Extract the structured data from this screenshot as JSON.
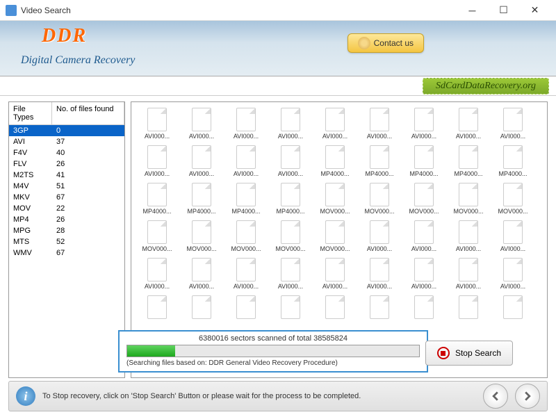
{
  "window": {
    "title": "Video Search"
  },
  "header": {
    "logo": "DDR",
    "subtitle": "Digital Camera Recovery",
    "contact": "Contact us",
    "banner": "SdCardDataRecovery.org"
  },
  "table": {
    "col1": "File Types",
    "col2": "No. of files found",
    "rows": [
      {
        "type": "3GP",
        "count": "0",
        "selected": true
      },
      {
        "type": "AVI",
        "count": "37"
      },
      {
        "type": "F4V",
        "count": "40"
      },
      {
        "type": "FLV",
        "count": "26"
      },
      {
        "type": "M2TS",
        "count": "41"
      },
      {
        "type": "M4V",
        "count": "51"
      },
      {
        "type": "MKV",
        "count": "67"
      },
      {
        "type": "MOV",
        "count": "22"
      },
      {
        "type": "MP4",
        "count": "26"
      },
      {
        "type": "MPG",
        "count": "28"
      },
      {
        "type": "MTS",
        "count": "52"
      },
      {
        "type": "WMV",
        "count": "67"
      }
    ]
  },
  "grid": {
    "rows": [
      [
        "AVI000...",
        "AVI000...",
        "AVI000...",
        "AVI000...",
        "AVI000...",
        "AVI000...",
        "AVI000...",
        "AVI000...",
        "AVI000..."
      ],
      [
        "AVI000...",
        "AVI000...",
        "AVI000...",
        "AVI000...",
        "MP4000...",
        "MP4000...",
        "MP4000...",
        "MP4000...",
        "MP4000..."
      ],
      [
        "MP4000...",
        "MP4000...",
        "MP4000...",
        "MP4000...",
        "MOV000...",
        "MOV000...",
        "MOV000...",
        "MOV000...",
        "MOV000..."
      ],
      [
        "MOV000...",
        "MOV000...",
        "MOV000...",
        "MOV000...",
        "MOV000...",
        "AVI000...",
        "AVI000...",
        "AVI000...",
        "AVI000..."
      ],
      [
        "AVI000...",
        "AVI000...",
        "AVI000...",
        "AVI000...",
        "AVI000...",
        "AVI000...",
        "AVI000...",
        "AVI000...",
        "AVI000..."
      ],
      [
        "",
        "",
        "",
        "",
        "",
        "",
        "",
        "",
        ""
      ]
    ]
  },
  "progress": {
    "text": "6380016 sectors scanned of total 38585824",
    "sub": "(Searching files based on:  DDR General Video Recovery Procedure)",
    "percent": 16.5
  },
  "stop": "Stop Search",
  "footer": {
    "text": "To Stop recovery, click on 'Stop Search' Button or please wait for the process to be completed."
  }
}
